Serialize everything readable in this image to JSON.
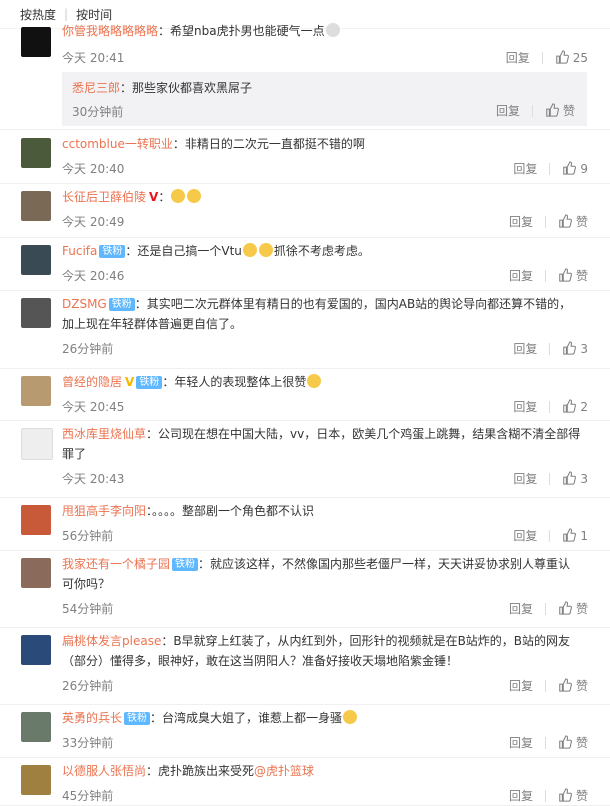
{
  "sort": {
    "hot": "按热度",
    "time": "按时间"
  },
  "actions": {
    "reply": "回复",
    "like": "赞"
  },
  "colors": {
    "username": "#eb7350",
    "meta": "#808080"
  },
  "comments": [
    {
      "user": "你管我略略略略略",
      "badges": [],
      "text": "：希望nba虎扑男也能硬气一点",
      "time": "今天 20:41",
      "likes": "25",
      "reply": {
        "user": "悉尼三郎",
        "text": "：那些家伙都喜欢黑屌子",
        "time": "30分钟前",
        "likes": "赞"
      }
    },
    {
      "user": "cctomblue一转职业",
      "badges": [],
      "text": "：非精日的二次元一直都挺不错的啊",
      "time": "今天 20:40",
      "likes": "9"
    },
    {
      "user": "长征后卫薛伯陵",
      "badges": [],
      "text": "：",
      "time": "今天 20:49",
      "likes": "赞"
    },
    {
      "user": "Fucifa",
      "badges": [
        "铁粉"
      ],
      "text": "：还是自己搞一个Vtu",
      "text2": "抓徐不考虑考虑。",
      "time": "今天 20:46",
      "likes": "赞"
    },
    {
      "user": "DZSMG",
      "badges": [
        "铁粉"
      ],
      "text": "：其实吧二次元群体里有精日的也有爱国的，国内AB站的舆论导向都还算不错的，",
      "text_b": "加上现在年轻群体普遍更自信了。",
      "time": "26分钟前",
      "likes": "3"
    },
    {
      "user": "曾经的隐居",
      "badges": [
        "铁粉"
      ],
      "text": "：年轻人的表现整体上很赞",
      "time": "今天 20:45",
      "likes": "2"
    },
    {
      "user": "西冰库里烧仙草",
      "badges": [],
      "text": "：公司现在想在中国大陆，vv，日本，欧美几个鸡蛋上跳舞，结果含糊不清全部得",
      "text_b": "罪了",
      "time": "今天 20:43",
      "likes": "3"
    },
    {
      "user": "甩狙高手李向阳",
      "badges": [],
      "text": "：。。。。整部剧一个角色都不认识",
      "time": "56分钟前",
      "likes": "1"
    },
    {
      "user": "我家还有一个橘子园",
      "badges": [
        "铁粉"
      ],
      "text": "：就应该这样，不然像国内那些老僵尸一样，天天讲妥协求别人尊重认",
      "text_b": "可你吗？",
      "time": "54分钟前",
      "likes": "赞"
    },
    {
      "user": "扁桃体发言please",
      "badges": [],
      "text": "：B早就穿上红装了，从内红到外，回形针的视频就是在B站炸的，B站的网友",
      "text_b": "（部分）懂得多，眼神好，敢在这当阴阳人？准备好接收天塌地陷紫金锤！",
      "time": "26分钟前",
      "likes": "赞"
    },
    {
      "user": "英勇的兵长",
      "badges": [
        "铁粉"
      ],
      "text": "：台湾成臭大姐了，谁惹上都一身骚",
      "time": "33分钟前",
      "likes": "赞"
    },
    {
      "user": "以德服人张悟尚",
      "badges": [],
      "text": "：虎扑跪族出来受死",
      "mention": "@虎扑篮球",
      "time": "45分钟前",
      "likes": "赞"
    }
  ]
}
